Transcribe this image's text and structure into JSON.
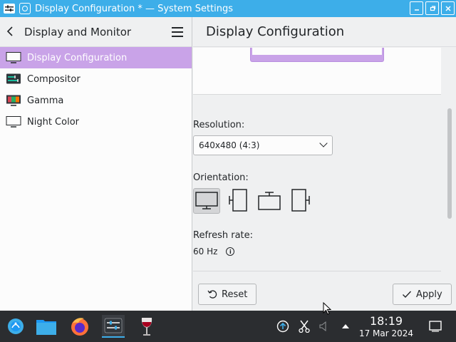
{
  "window": {
    "title": "Display Configuration * — System Settings",
    "controls": [
      "minimize-icon",
      "maximize-icon",
      "close-icon"
    ]
  },
  "sidebar": {
    "title": "Display and Monitor",
    "items": [
      {
        "label": "Display Configuration",
        "icon": "monitor-icon",
        "active": true
      },
      {
        "label": "Compositor",
        "icon": "compositor-icon",
        "active": false
      },
      {
        "label": "Gamma",
        "icon": "gamma-icon",
        "active": false
      },
      {
        "label": "Night Color",
        "icon": "night-color-icon",
        "active": false
      }
    ]
  },
  "main": {
    "title": "Display Configuration",
    "resolution": {
      "label": "Resolution:",
      "value": "640x480 (4:3)"
    },
    "orientation": {
      "label": "Orientation:",
      "options": [
        "landscape",
        "portrait-left",
        "landscape-flipped",
        "portrait-right"
      ],
      "selected": "landscape"
    },
    "refresh": {
      "label": "Refresh rate:",
      "value": "60 Hz"
    },
    "buttons": {
      "reset": "Reset",
      "apply": "Apply"
    }
  },
  "taskbar": {
    "apps": [
      "app-launcher-icon",
      "file-manager-icon",
      "firefox-icon",
      "system-settings-icon",
      "wine-icon"
    ],
    "tray": [
      "update-icon",
      "scissors-icon",
      "volume-icon",
      "tray-expand-icon"
    ],
    "clock": {
      "time": "18:19",
      "date": "17 Mar 2024"
    }
  },
  "colors": {
    "accent": "#3daee9",
    "selection": "#c9a3e8",
    "panel": "#2b2d30"
  }
}
